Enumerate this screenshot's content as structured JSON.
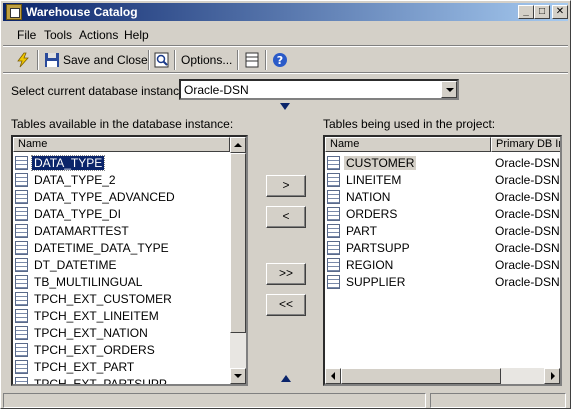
{
  "window": {
    "title": "Warehouse Catalog",
    "min_label": "_",
    "max_label": "□",
    "close_label": "✕"
  },
  "menu": [
    {
      "label": "File"
    },
    {
      "label": "Tools"
    },
    {
      "label": "Actions"
    },
    {
      "label": "Help"
    }
  ],
  "toolbar": {
    "save_close_label": "Save and Close",
    "options_label": "Options..."
  },
  "instance": {
    "label": "Select current database instance",
    "value": "Oracle-DSN"
  },
  "available": {
    "label": "Tables available in the database instance:",
    "col_name": "Name",
    "rows": [
      "DATA_TYPE",
      "DATA_TYPE_2",
      "DATA_TYPE_ADVANCED",
      "DATA_TYPE_DI",
      "DATAMARTTEST",
      "DATETIME_DATA_TYPE",
      "DT_DATETIME",
      "TB_MULTILINGUAL",
      "TPCH_EXT_CUSTOMER",
      "TPCH_EXT_LINEITEM",
      "TPCH_EXT_NATION",
      "TPCH_EXT_ORDERS",
      "TPCH_EXT_PART",
      "TPCH_EXT_PARTSUPP"
    ]
  },
  "used": {
    "label": "Tables being used in the project:",
    "col_name": "Name",
    "col_db": "Primary DB In",
    "rows": [
      {
        "name": "CUSTOMER",
        "db": "Oracle-DSN <"
      },
      {
        "name": "LINEITEM",
        "db": "Oracle-DSN <"
      },
      {
        "name": "NATION",
        "db": "Oracle-DSN <"
      },
      {
        "name": "ORDERS",
        "db": "Oracle-DSN <"
      },
      {
        "name": "PART",
        "db": "Oracle-DSN <"
      },
      {
        "name": "PARTSUPP",
        "db": "Oracle-DSN <"
      },
      {
        "name": "REGION",
        "db": "Oracle-DSN <"
      },
      {
        "name": "SUPPLIER",
        "db": "Oracle-DSN <"
      }
    ]
  },
  "buttons": {
    "add": ">",
    "remove": "<",
    "add_all": ">>",
    "remove_all": "<<"
  }
}
